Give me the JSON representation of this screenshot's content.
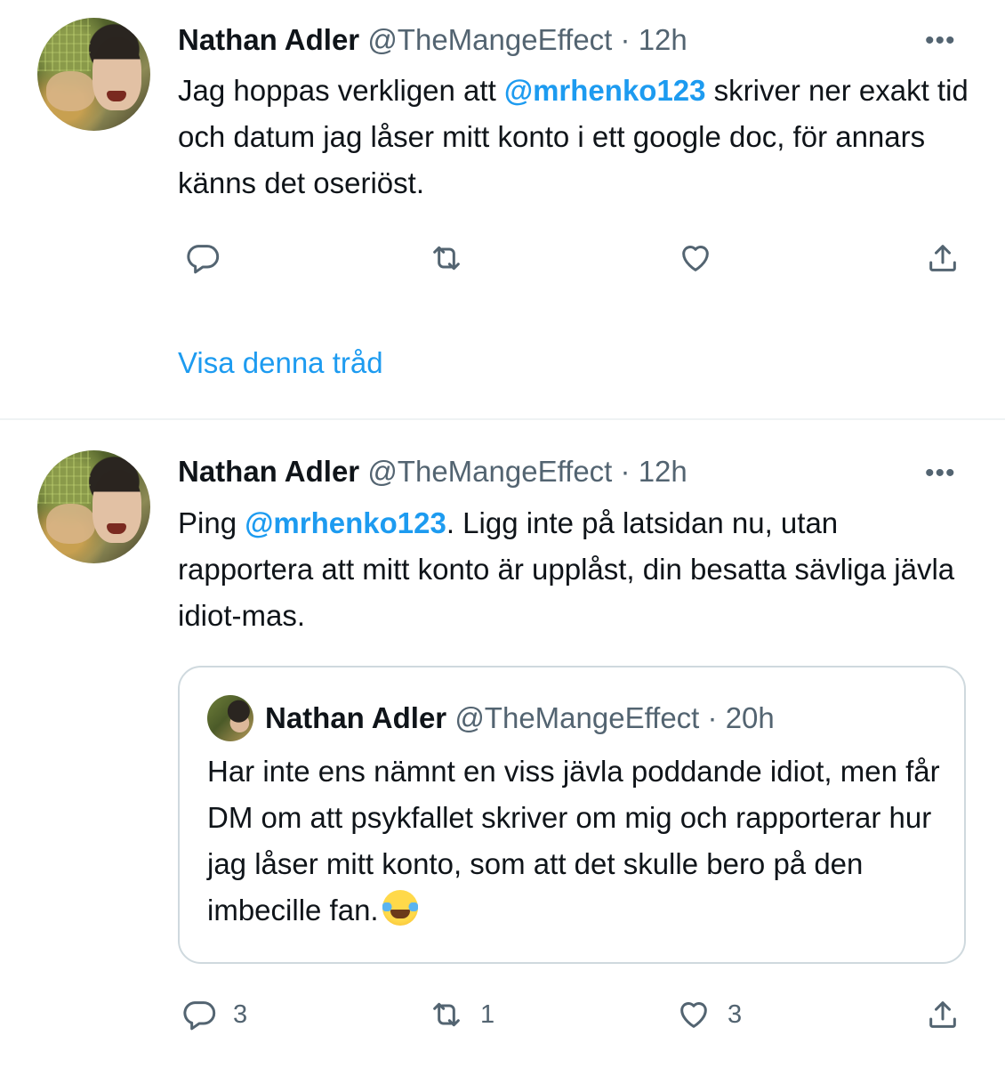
{
  "tweets": [
    {
      "author_name": "Nathan Adler",
      "handle": "@TheMangeEffect",
      "dot": "·",
      "time": "12h",
      "more": "•••",
      "text_before": "Jag hoppas verkligen att ",
      "mention": "@mrhenko123",
      "text_after": " skriver ner exakt tid och datum jag låser mitt konto i ett google doc, för annars känns det oseriöst.",
      "show_thread": "Visa denna tråd"
    },
    {
      "author_name": "Nathan Adler",
      "handle": "@TheMangeEffect",
      "dot": "·",
      "time": "12h",
      "more": "•••",
      "text_before": "Ping ",
      "mention": "@mrhenko123",
      "text_after": ". Ligg inte på latsidan nu, utan rapportera att mitt konto är upplåst, din besatta sävliga jävla idiot-mas.",
      "counts": {
        "replies": "3",
        "retweets": "1",
        "likes": "3"
      }
    }
  ],
  "quoted_tweet": {
    "author_name": "Nathan Adler",
    "handle": "@TheMangeEffect",
    "dot": "·",
    "time": "20h",
    "text": "Har inte ens nämnt en viss jävla poddande idiot, men får DM om att psykfallet skriver om mig och rapporterar hur jag låser mitt konto, som att det skulle bero på den imbecille fan.",
    "emoji": "face-with-tears-of-joy-emoji"
  },
  "icons": {
    "reply": "reply-icon",
    "retweet": "retweet-icon",
    "like": "heart-icon",
    "share": "share-icon"
  },
  "colors": {
    "accent": "#1d9bf0",
    "muted": "#536471",
    "text": "#0f1419",
    "border": "#cfd9de"
  }
}
